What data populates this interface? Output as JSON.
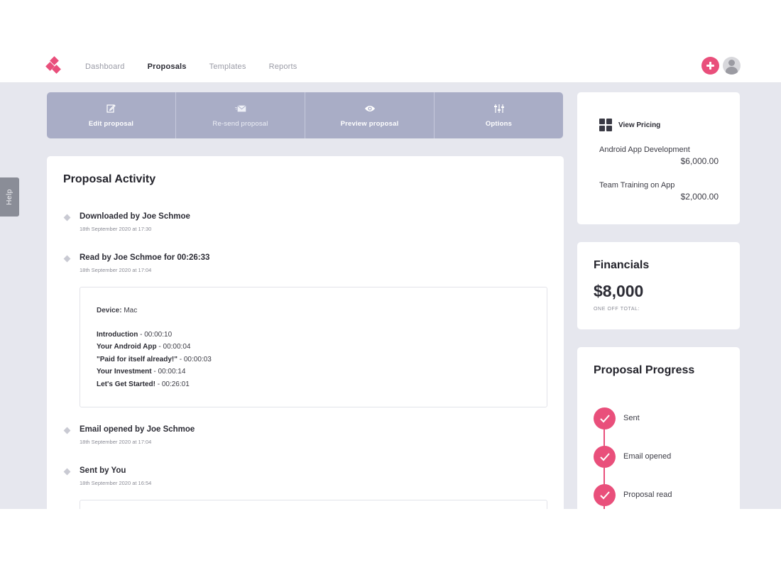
{
  "nav": {
    "items": [
      {
        "label": "Dashboard"
      },
      {
        "label": "Proposals"
      },
      {
        "label": "Templates"
      },
      {
        "label": "Reports"
      }
    ],
    "active": "Proposals"
  },
  "help_label": "Help",
  "toolbar": {
    "edit_label": "Edit proposal",
    "resend_label": "Re-send proposal",
    "preview_label": "Preview proposal",
    "options_label": "Options"
  },
  "activity": {
    "title": "Proposal Activity",
    "events": [
      {
        "title": "Downloaded by Joe Schmoe",
        "time": "18th September 2020 at 17:30"
      },
      {
        "title": "Read by Joe Schmoe for 00:26:33",
        "time": "18th September 2020 at 17:04"
      },
      {
        "title": "Email opened by Joe Schmoe",
        "time": "18th September 2020 at 17:04"
      },
      {
        "title": "Sent by You",
        "time": "18th September 2020 at 16:54"
      }
    ],
    "detail": {
      "device_label": "Device:",
      "device_value": " Mac",
      "sections": [
        {
          "name": "Introduction",
          "duration": " - 00:00:10"
        },
        {
          "name": "Your Android App",
          "duration": " - 00:00:04"
        },
        {
          "name": "\"Paid for itself already!\"",
          "duration": " - 00:00:03"
        },
        {
          "name": "Your Investment",
          "duration": " - 00:00:14"
        },
        {
          "name": "Let's Get Started!",
          "duration": " - 00:26:01"
        }
      ]
    }
  },
  "pricing": {
    "header": "View Pricing",
    "items": [
      {
        "name": "Android App Development",
        "amount": "$6,000.00"
      },
      {
        "name": "Team Training on App",
        "amount": "$2,000.00"
      }
    ]
  },
  "financials": {
    "title": "Financials",
    "total": "$8,000",
    "sub": "ONE OFF TOTAL:"
  },
  "progress": {
    "title": "Proposal Progress",
    "steps": [
      {
        "label": "Sent"
      },
      {
        "label": "Email opened"
      },
      {
        "label": "Proposal read"
      }
    ]
  },
  "colors": {
    "accent": "#e94f7b",
    "toolbar": "#a9adc6",
    "workspace": "#e6e7ee"
  }
}
